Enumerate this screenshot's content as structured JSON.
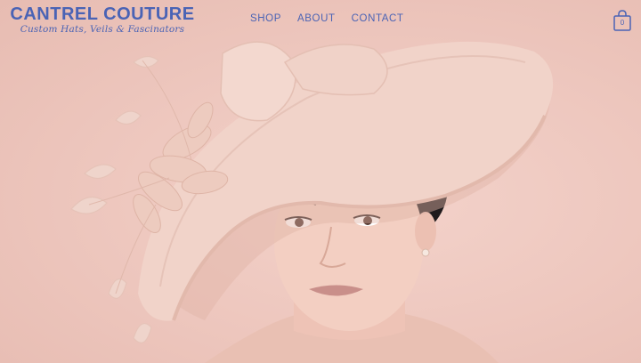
{
  "brand": {
    "name": "CANTREL COUTURE",
    "tagline": "Custom Hats, Veils & Fascinators"
  },
  "nav": {
    "items": [
      {
        "label": "SHOP"
      },
      {
        "label": "ABOUT"
      },
      {
        "label": "CONTACT"
      }
    ]
  },
  "cart": {
    "icon": "shopping-bag-icon",
    "count": "0"
  },
  "hero": {
    "image": "model-wearing-wide-brim-blush-hat"
  },
  "colors": {
    "accent": "#4a63b5",
    "background": "#efc9c1",
    "hat": "#f1d3c9"
  }
}
